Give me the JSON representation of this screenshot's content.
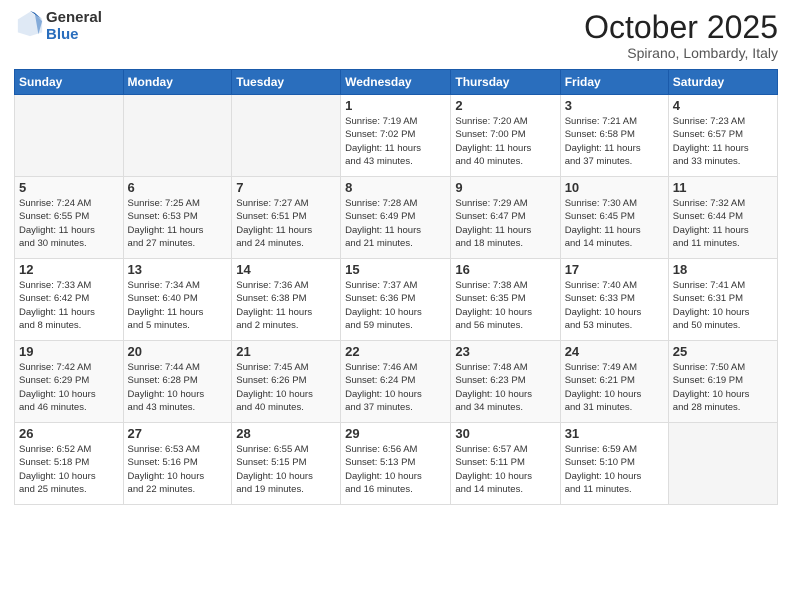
{
  "header": {
    "logo": {
      "line1": "General",
      "line2": "Blue"
    },
    "title": "October 2025",
    "subtitle": "Spirano, Lombardy, Italy"
  },
  "days_of_week": [
    "Sunday",
    "Monday",
    "Tuesday",
    "Wednesday",
    "Thursday",
    "Friday",
    "Saturday"
  ],
  "weeks": [
    {
      "days": [
        {
          "date": "",
          "info": ""
        },
        {
          "date": "",
          "info": ""
        },
        {
          "date": "",
          "info": ""
        },
        {
          "date": "1",
          "info": "Sunrise: 7:19 AM\nSunset: 7:02 PM\nDaylight: 11 hours\nand 43 minutes."
        },
        {
          "date": "2",
          "info": "Sunrise: 7:20 AM\nSunset: 7:00 PM\nDaylight: 11 hours\nand 40 minutes."
        },
        {
          "date": "3",
          "info": "Sunrise: 7:21 AM\nSunset: 6:58 PM\nDaylight: 11 hours\nand 37 minutes."
        },
        {
          "date": "4",
          "info": "Sunrise: 7:23 AM\nSunset: 6:57 PM\nDaylight: 11 hours\nand 33 minutes."
        }
      ]
    },
    {
      "days": [
        {
          "date": "5",
          "info": "Sunrise: 7:24 AM\nSunset: 6:55 PM\nDaylight: 11 hours\nand 30 minutes."
        },
        {
          "date": "6",
          "info": "Sunrise: 7:25 AM\nSunset: 6:53 PM\nDaylight: 11 hours\nand 27 minutes."
        },
        {
          "date": "7",
          "info": "Sunrise: 7:27 AM\nSunset: 6:51 PM\nDaylight: 11 hours\nand 24 minutes."
        },
        {
          "date": "8",
          "info": "Sunrise: 7:28 AM\nSunset: 6:49 PM\nDaylight: 11 hours\nand 21 minutes."
        },
        {
          "date": "9",
          "info": "Sunrise: 7:29 AM\nSunset: 6:47 PM\nDaylight: 11 hours\nand 18 minutes."
        },
        {
          "date": "10",
          "info": "Sunrise: 7:30 AM\nSunset: 6:45 PM\nDaylight: 11 hours\nand 14 minutes."
        },
        {
          "date": "11",
          "info": "Sunrise: 7:32 AM\nSunset: 6:44 PM\nDaylight: 11 hours\nand 11 minutes."
        }
      ]
    },
    {
      "days": [
        {
          "date": "12",
          "info": "Sunrise: 7:33 AM\nSunset: 6:42 PM\nDaylight: 11 hours\nand 8 minutes."
        },
        {
          "date": "13",
          "info": "Sunrise: 7:34 AM\nSunset: 6:40 PM\nDaylight: 11 hours\nand 5 minutes."
        },
        {
          "date": "14",
          "info": "Sunrise: 7:36 AM\nSunset: 6:38 PM\nDaylight: 11 hours\nand 2 minutes."
        },
        {
          "date": "15",
          "info": "Sunrise: 7:37 AM\nSunset: 6:36 PM\nDaylight: 10 hours\nand 59 minutes."
        },
        {
          "date": "16",
          "info": "Sunrise: 7:38 AM\nSunset: 6:35 PM\nDaylight: 10 hours\nand 56 minutes."
        },
        {
          "date": "17",
          "info": "Sunrise: 7:40 AM\nSunset: 6:33 PM\nDaylight: 10 hours\nand 53 minutes."
        },
        {
          "date": "18",
          "info": "Sunrise: 7:41 AM\nSunset: 6:31 PM\nDaylight: 10 hours\nand 50 minutes."
        }
      ]
    },
    {
      "days": [
        {
          "date": "19",
          "info": "Sunrise: 7:42 AM\nSunset: 6:29 PM\nDaylight: 10 hours\nand 46 minutes."
        },
        {
          "date": "20",
          "info": "Sunrise: 7:44 AM\nSunset: 6:28 PM\nDaylight: 10 hours\nand 43 minutes."
        },
        {
          "date": "21",
          "info": "Sunrise: 7:45 AM\nSunset: 6:26 PM\nDaylight: 10 hours\nand 40 minutes."
        },
        {
          "date": "22",
          "info": "Sunrise: 7:46 AM\nSunset: 6:24 PM\nDaylight: 10 hours\nand 37 minutes."
        },
        {
          "date": "23",
          "info": "Sunrise: 7:48 AM\nSunset: 6:23 PM\nDaylight: 10 hours\nand 34 minutes."
        },
        {
          "date": "24",
          "info": "Sunrise: 7:49 AM\nSunset: 6:21 PM\nDaylight: 10 hours\nand 31 minutes."
        },
        {
          "date": "25",
          "info": "Sunrise: 7:50 AM\nSunset: 6:19 PM\nDaylight: 10 hours\nand 28 minutes."
        }
      ]
    },
    {
      "days": [
        {
          "date": "26",
          "info": "Sunrise: 6:52 AM\nSunset: 5:18 PM\nDaylight: 10 hours\nand 25 minutes."
        },
        {
          "date": "27",
          "info": "Sunrise: 6:53 AM\nSunset: 5:16 PM\nDaylight: 10 hours\nand 22 minutes."
        },
        {
          "date": "28",
          "info": "Sunrise: 6:55 AM\nSunset: 5:15 PM\nDaylight: 10 hours\nand 19 minutes."
        },
        {
          "date": "29",
          "info": "Sunrise: 6:56 AM\nSunset: 5:13 PM\nDaylight: 10 hours\nand 16 minutes."
        },
        {
          "date": "30",
          "info": "Sunrise: 6:57 AM\nSunset: 5:11 PM\nDaylight: 10 hours\nand 14 minutes."
        },
        {
          "date": "31",
          "info": "Sunrise: 6:59 AM\nSunset: 5:10 PM\nDaylight: 10 hours\nand 11 minutes."
        },
        {
          "date": "",
          "info": ""
        }
      ]
    }
  ]
}
